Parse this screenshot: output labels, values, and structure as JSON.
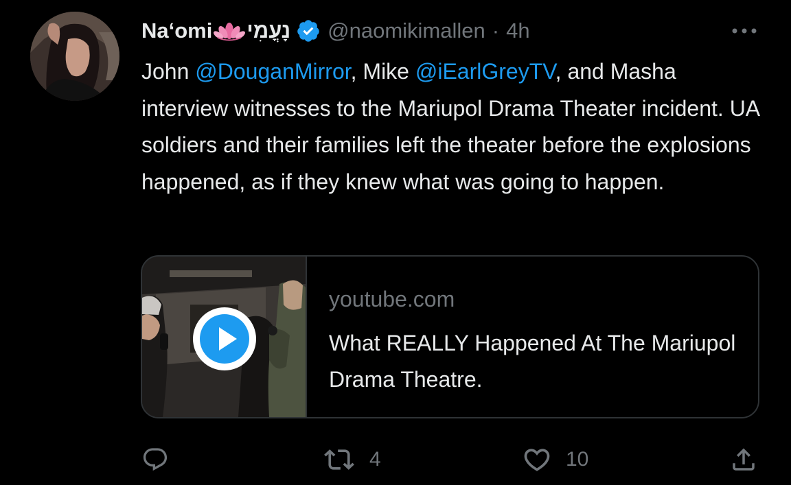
{
  "tweet": {
    "author": {
      "display_name": "Naʻomi",
      "display_name_emoji": "lotus-emoji",
      "hebrew_name": "נָעֳמִי",
      "verified": true,
      "handle": "@naomikimallen",
      "separator": "·",
      "time": "4h"
    },
    "text": {
      "part1": "John ",
      "mention1": "@DouganMirror",
      "part2": ", Mike ",
      "mention2": "@iEarlGreyTV",
      "part3": ", and Masha interview witnesses to the Mariupol Drama Theater incident. UA soldiers and their families left the theater before the explosions happened, as if they knew what was going to happen."
    },
    "card": {
      "domain": "youtube.com",
      "title": "What REALLY Happened At The Mariupol Drama Theatre.",
      "thumbnail_icon": "video-thumbnail",
      "play_icon": "play-icon"
    },
    "actions": {
      "reply_count": "",
      "retweet_count": "4",
      "like_count": "10"
    }
  },
  "colors": {
    "background": "#000000",
    "text": "#e7e9ea",
    "secondary": "#71767b",
    "accent": "#1d9bf0",
    "border": "#2f3336"
  }
}
